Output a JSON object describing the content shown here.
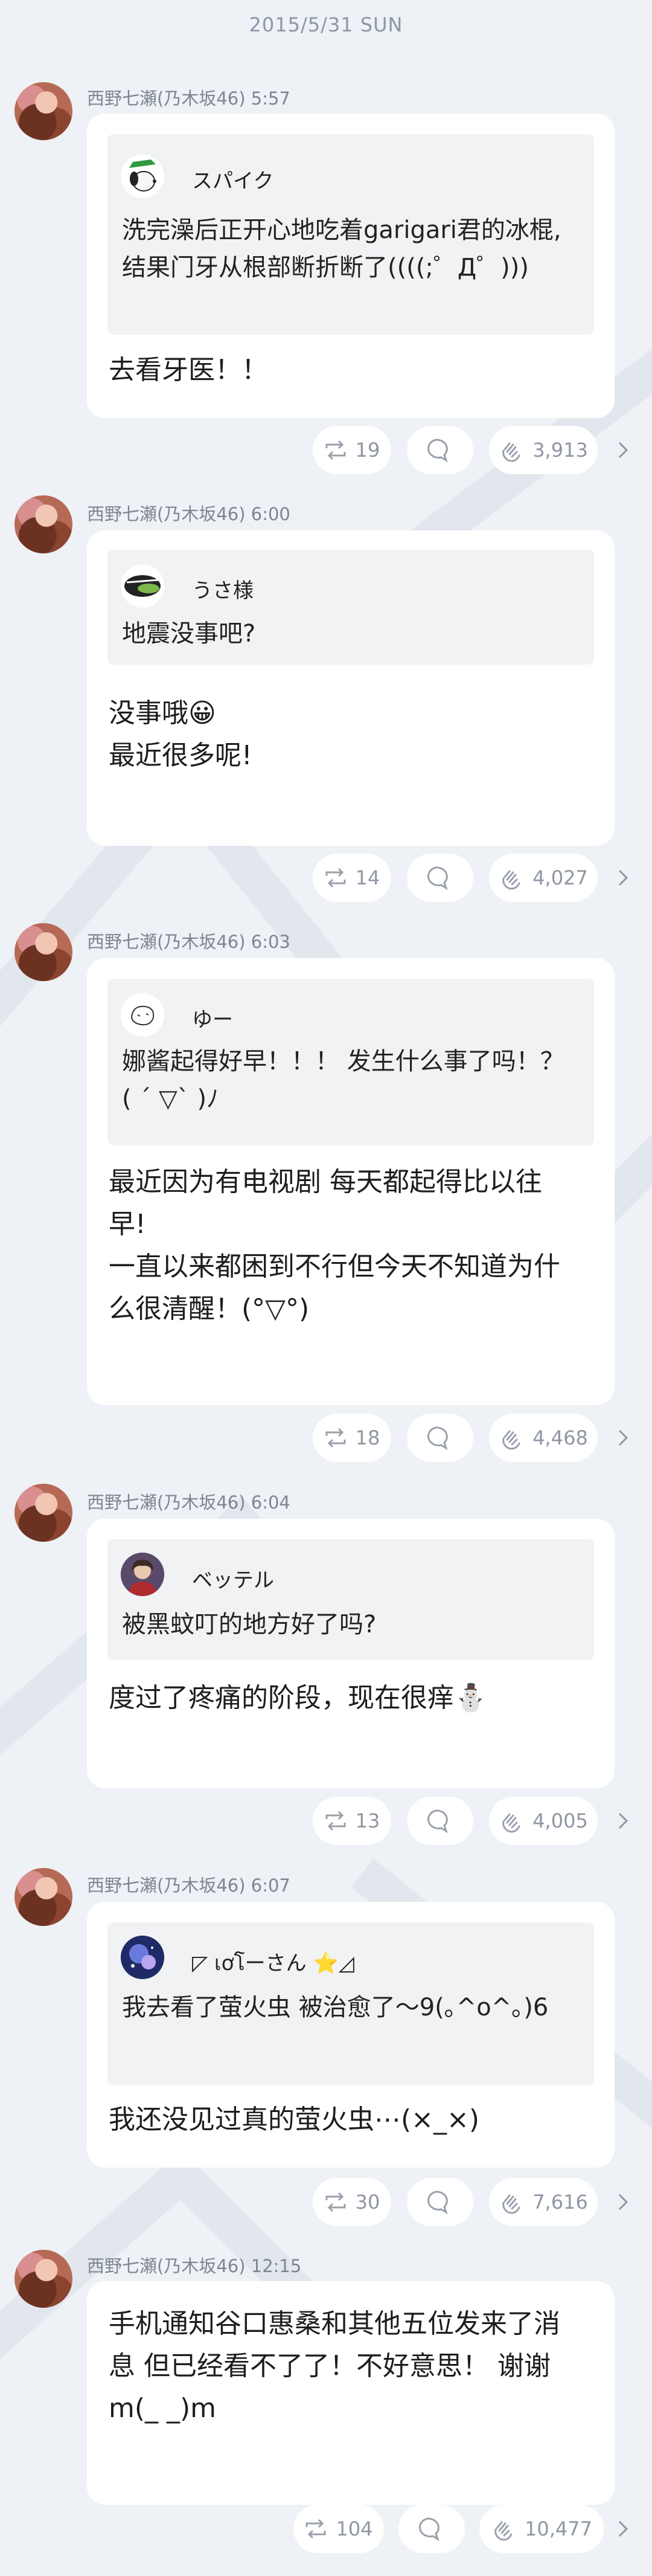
{
  "date_header": "2015/5/31 SUN",
  "posts": [
    {
      "author": "西野七瀬(乃木坂46)",
      "time": "5:57",
      "quote_name": "スパイク",
      "quote_text_lines": [
        "洗完澡后正开心地吃着garigari君的冰棍,",
        "结果门牙从根部断折断了((((;゜Д゜)))"
      ],
      "body_lines": [
        "去看牙医！！"
      ],
      "reposts": "19",
      "likes": "3,913"
    },
    {
      "author": "西野七瀬(乃木坂46)",
      "time": "6:00",
      "quote_name": "うさ様",
      "quote_text_lines": [
        "地震没事吧?"
      ],
      "body_lines": [
        "没事哦😀",
        "最近很多呢!"
      ],
      "reposts": "14",
      "likes": "4,027"
    },
    {
      "author": "西野七瀬(乃木坂46)",
      "time": "6:03",
      "quote_name": "ゆー",
      "quote_text_lines": [
        "娜酱起得好早！！！ 发生什么事了吗！？",
        "( ´ ▽` )ﾉ"
      ],
      "body_lines": [
        "最近因为有电视剧 每天都起得比以往",
        "早!",
        "一直以来都困到不行但今天不知道为什",
        "么很清醒！(°▽°)"
      ],
      "reposts": "18",
      "likes": "4,468"
    },
    {
      "author": "西野七瀬(乃木坂46)",
      "time": "6:04",
      "quote_name": "ベッテル",
      "quote_text_lines": [
        "被黑蚊叮的地方好了吗?"
      ],
      "body_lines": [
        "度过了疼痛的阶段，现在很痒⛄"
      ],
      "reposts": "13",
      "likes": "4,005"
    },
    {
      "author": "西野七瀬(乃木坂46)",
      "time": "6:07",
      "quote_name": "◸ เơโーさん ⭐◿",
      "quote_text_lines": [
        "我去看了萤火虫 被治愈了～9(｡^o^｡)6"
      ],
      "body_lines": [
        "我还没见过真的萤火虫⋯(×_×)"
      ],
      "reposts": "30",
      "likes": "7,616"
    },
    {
      "author": "西野七瀬(乃木坂46)",
      "time": "12:15",
      "quote_name": "",
      "quote_text_lines": [],
      "body_lines": [
        "手机通知谷口惠桑和其他五位发来了消",
        "息 但已经看不了了！不好意思！ 谢谢",
        "m(_ _)m"
      ],
      "reposts": "104",
      "likes": "10,477"
    }
  ],
  "icons": {
    "repost": "repost-icon",
    "comment": "comment-icon",
    "like": "clap-hand-icon",
    "more": "chevron-right-icon"
  },
  "colors": {
    "background": "#eef1f5",
    "card": "#ffffff",
    "quote": "#f1f2f4",
    "muted": "#8f96a3"
  }
}
